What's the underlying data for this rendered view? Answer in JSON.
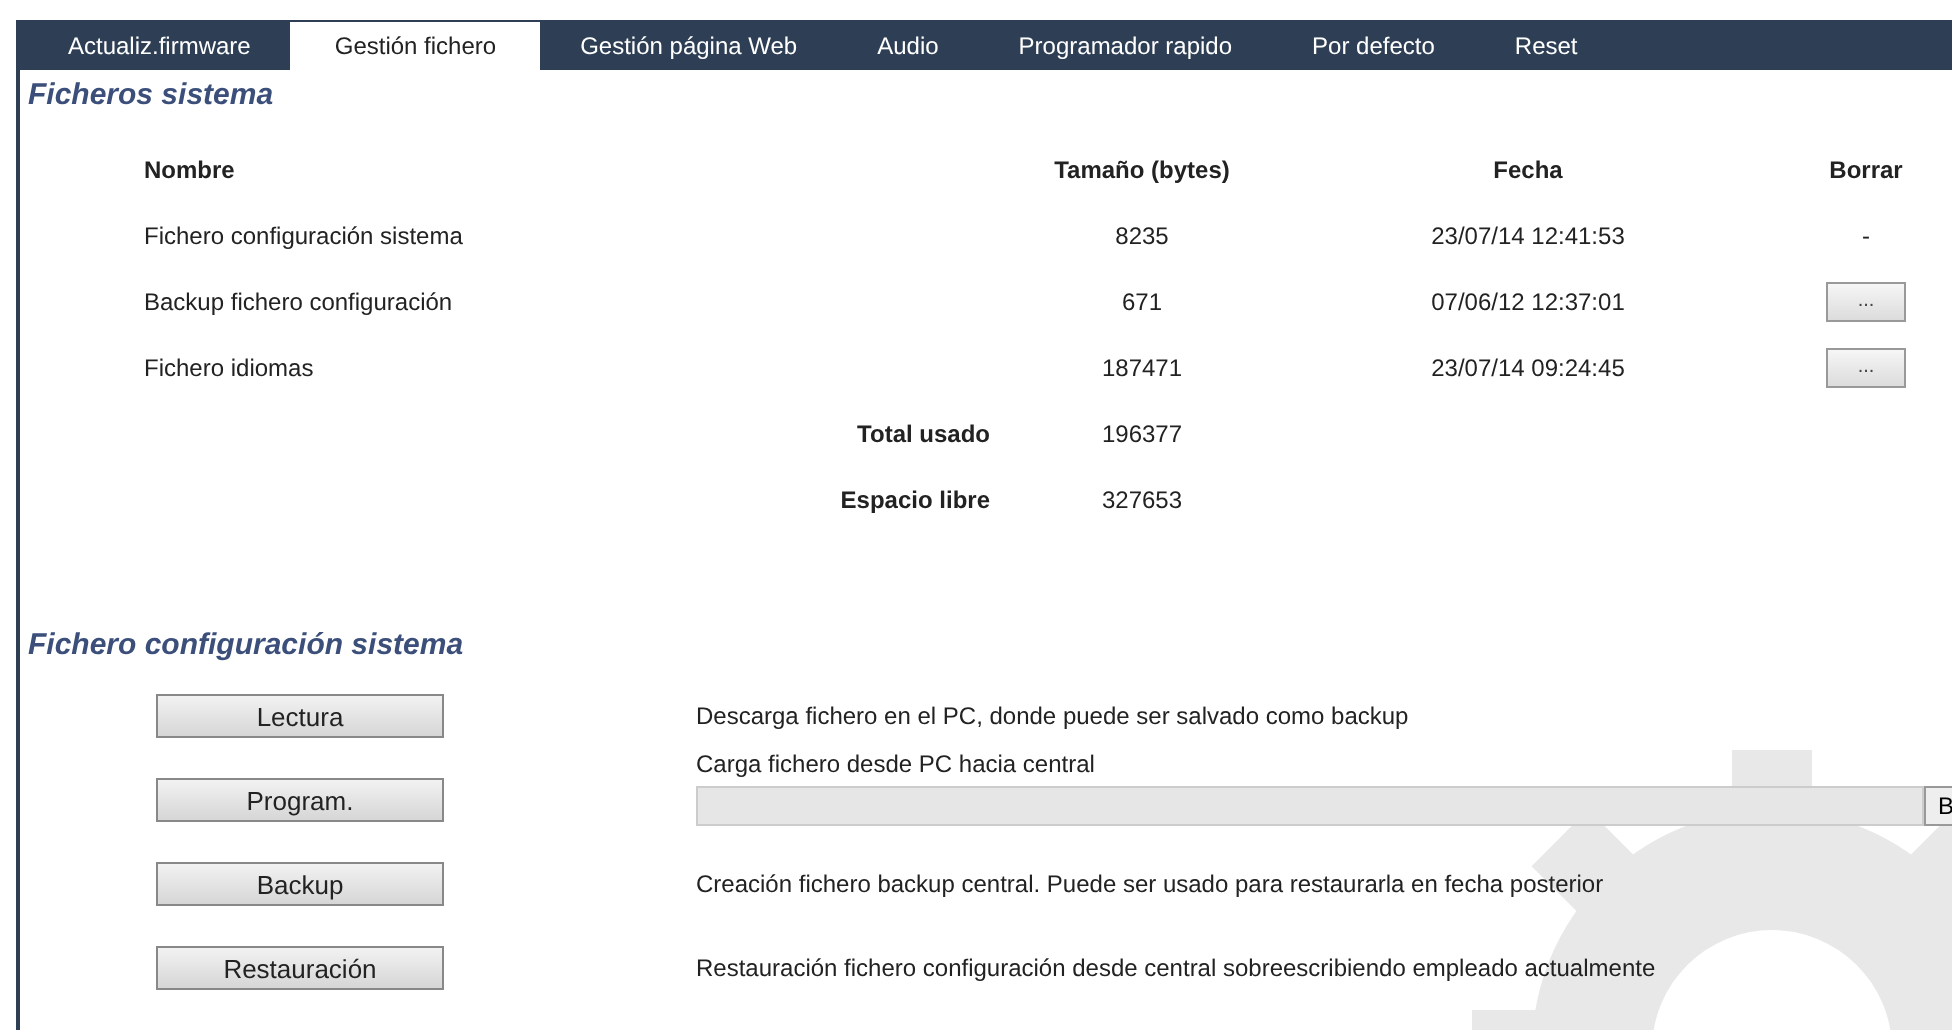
{
  "tabs": [
    {
      "label": "Actualiz.firmware",
      "selected": false
    },
    {
      "label": "Gestión fichero",
      "selected": true
    },
    {
      "label": "Gestión página Web",
      "selected": false
    },
    {
      "label": "Audio",
      "selected": false
    },
    {
      "label": "Programador rapido",
      "selected": false
    },
    {
      "label": "Por defecto",
      "selected": false
    },
    {
      "label": "Reset",
      "selected": false
    }
  ],
  "system_files": {
    "title": "Ficheros sistema",
    "columns": [
      "Nombre",
      "Tamaño (bytes)",
      "Fecha",
      "Borrar"
    ],
    "rows": [
      {
        "name": "Fichero configuración sistema",
        "size": "8235",
        "date": "23/07/14 12:41:53",
        "delete": {
          "kind": "text",
          "label": "-"
        }
      },
      {
        "name": "Backup fichero configuración",
        "size": "671",
        "date": "07/06/12 12:37:01",
        "delete": {
          "kind": "button",
          "label": "..."
        }
      },
      {
        "name": "Fichero idiomas",
        "size": "187471",
        "date": "23/07/14 09:24:45",
        "delete": {
          "kind": "button",
          "label": "..."
        }
      }
    ],
    "totals": [
      {
        "label": "Total usado",
        "value": "196377"
      },
      {
        "label": "Espacio libre",
        "value": "327653"
      }
    ]
  },
  "config_file": {
    "title": "Fichero configuración sistema",
    "actions": [
      {
        "button": "Lectura",
        "description": "Descarga fichero en el PC, donde puede ser salvado como backup"
      },
      {
        "button": "Program.",
        "description": "Carga fichero desde PC hacia central",
        "file_field": {
          "button": "B"
        }
      },
      {
        "button": "Backup",
        "description": "Creación fichero backup central. Puede ser usado para restaurarla en fecha posterior"
      },
      {
        "button": "Restauración",
        "description": "Restauración fichero configuración desde central sobreescribiendo empleado actualmente"
      }
    ]
  }
}
